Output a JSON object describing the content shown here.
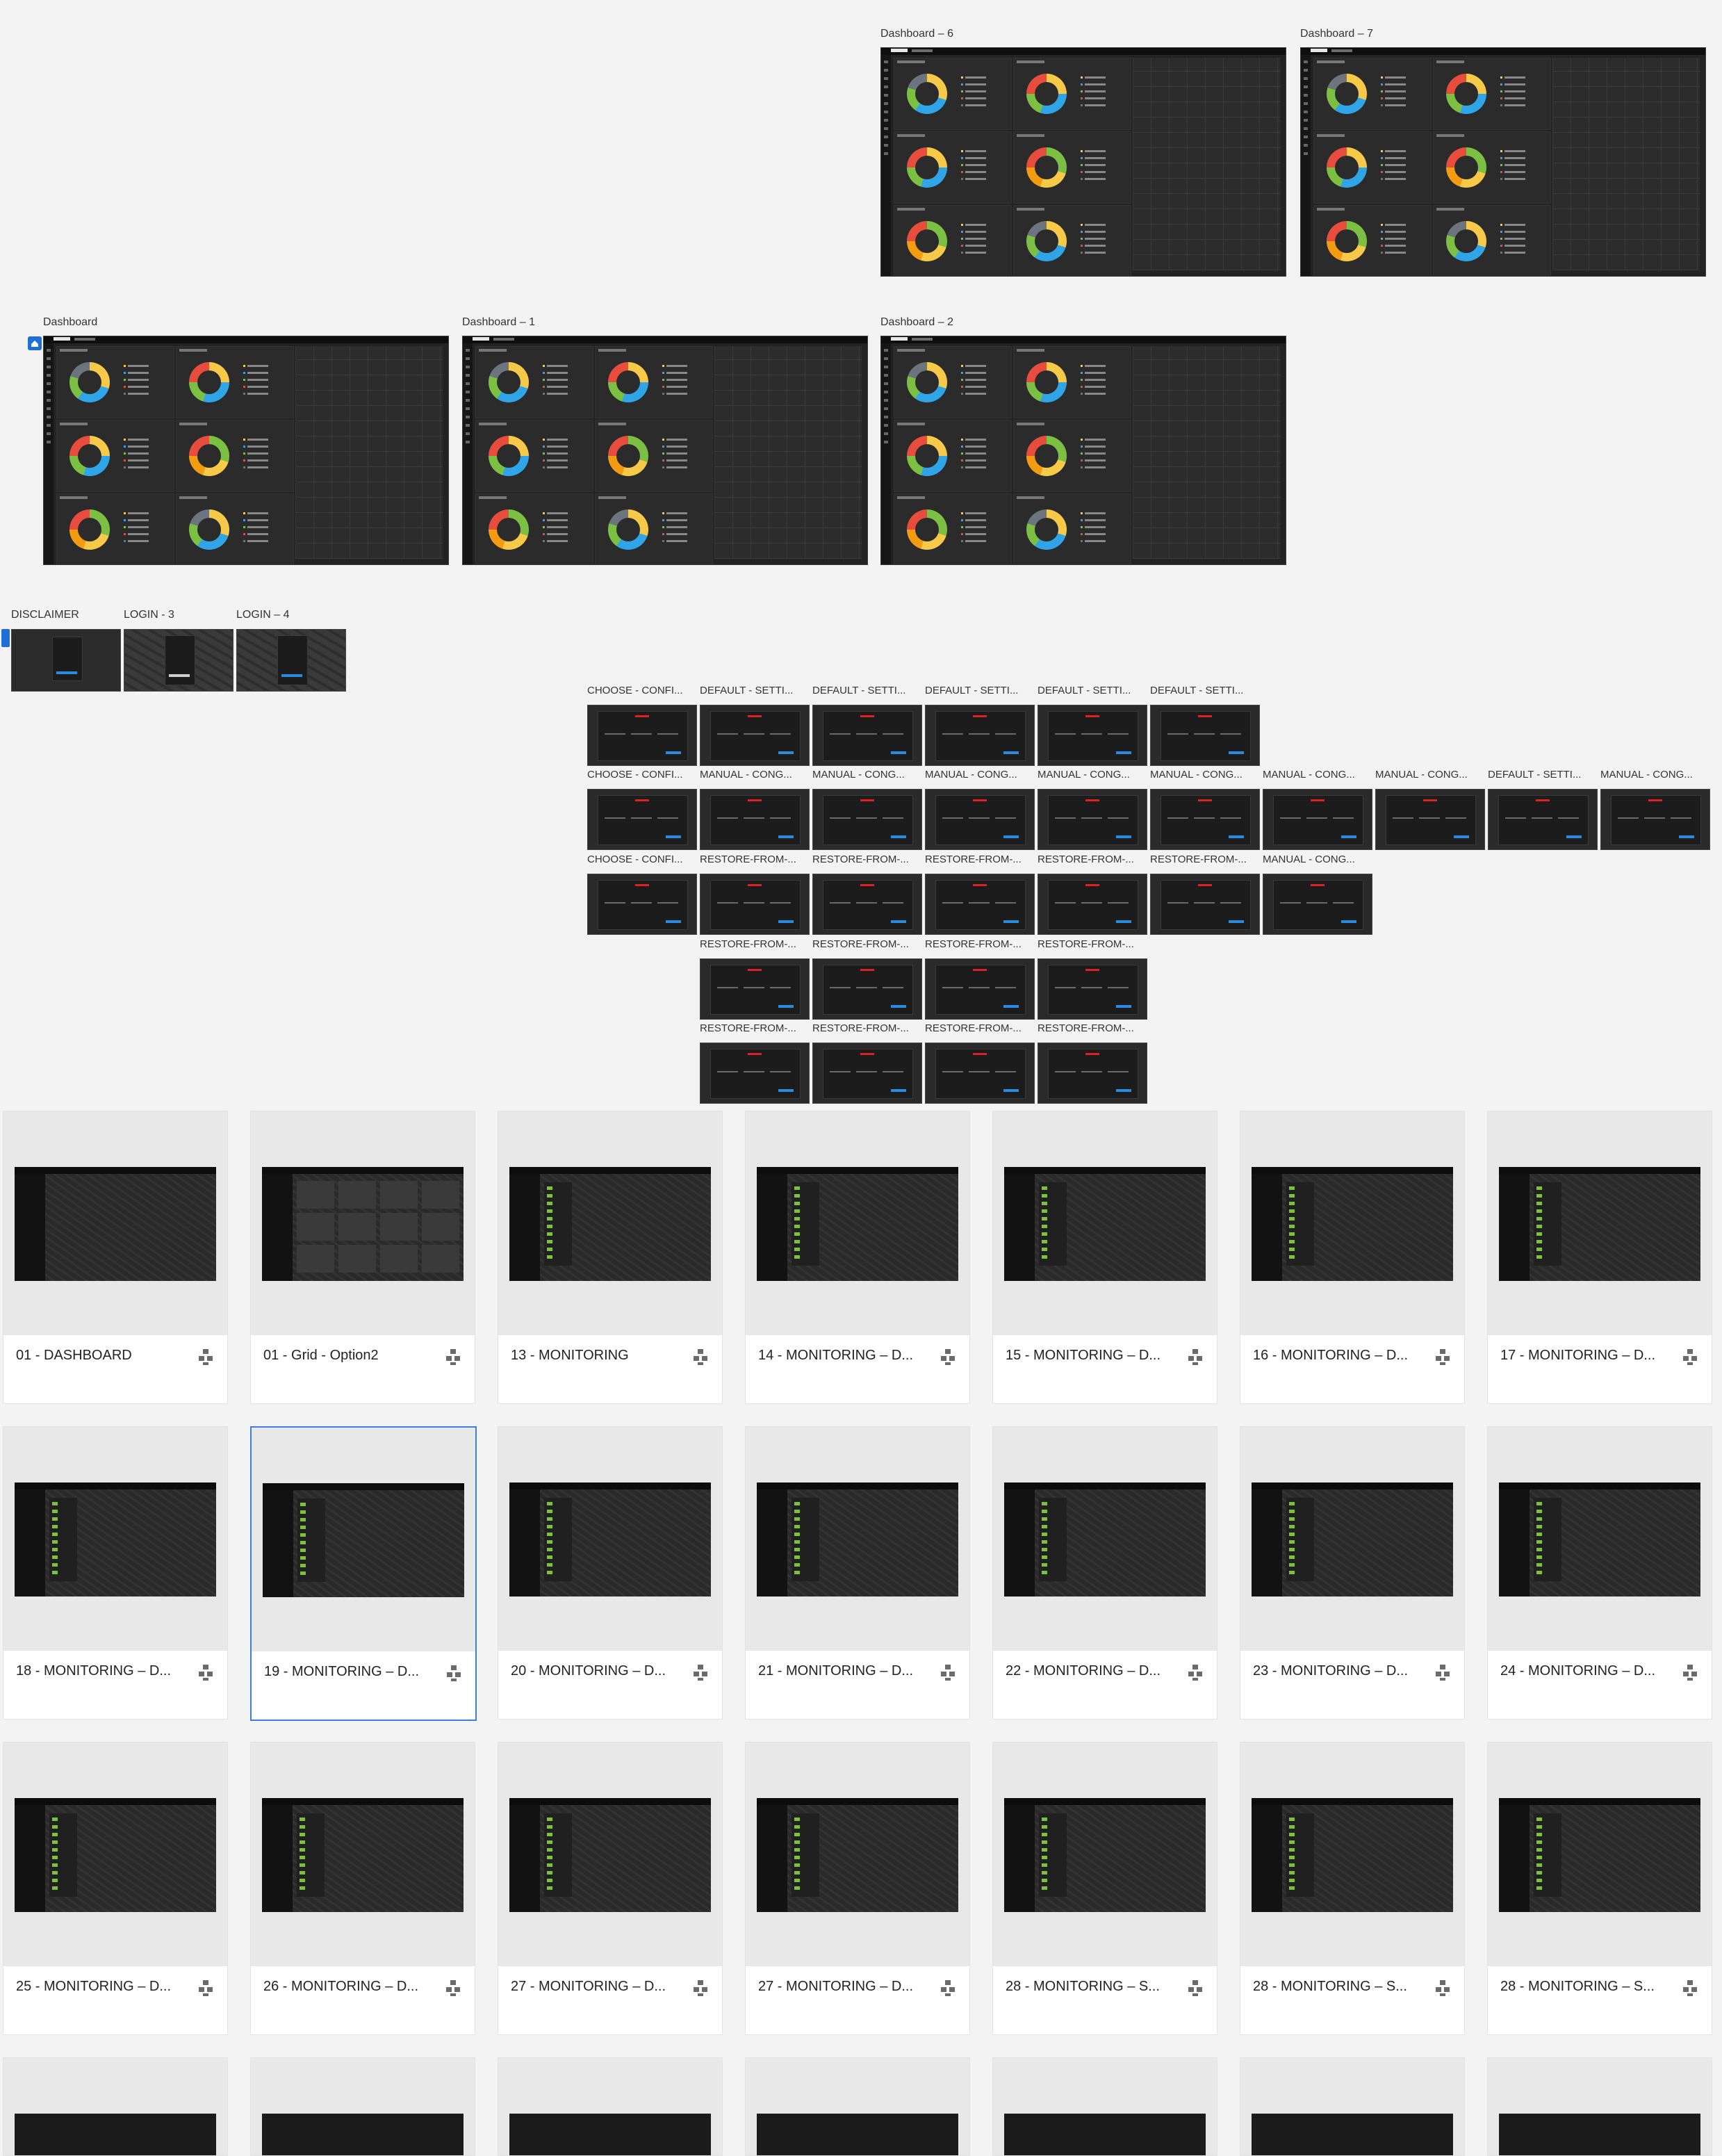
{
  "dashboards": {
    "top_row": [
      {
        "label": "Dashboard – 6"
      },
      {
        "label": "Dashboard – 7"
      }
    ],
    "middle_row": [
      {
        "label": "Dashboard"
      },
      {
        "label": "Dashboard – 1"
      },
      {
        "label": "Dashboard – 2"
      }
    ]
  },
  "login_row": [
    "DISCLAIMER",
    "LOGIN - 3",
    "LOGIN – 4"
  ],
  "wizard_labels": {
    "row1": [
      "CHOOSE - CONFI...",
      "DEFAULT - SETTI...",
      "DEFAULT - SETTI...",
      "DEFAULT - SETTI...",
      "DEFAULT - SETTI...",
      "DEFAULT - SETTI..."
    ],
    "row2": [
      "CHOOSE - CONFI...",
      "MANUAL - CONG...",
      "MANUAL - CONG...",
      "MANUAL - CONG...",
      "MANUAL - CONG...",
      "MANUAL - CONG...",
      "MANUAL - CONG...",
      "MANUAL - CONG...",
      "DEFAULT - SETTI...",
      "MANUAL - CONG..."
    ],
    "row3": [
      "CHOOSE - CONFI...",
      "RESTORE-FROM-...",
      "RESTORE-FROM-...",
      "RESTORE-FROM-...",
      "RESTORE-FROM-...",
      "RESTORE-FROM-...",
      "MANUAL - CONG..."
    ],
    "row4": [
      "RESTORE-FROM-...",
      "RESTORE-FROM-...",
      "RESTORE-FROM-...",
      "RESTORE-FROM-..."
    ],
    "row5": [
      "RESTORE-FROM-...",
      "RESTORE-FROM-...",
      "RESTORE-FROM-...",
      "RESTORE-FROM-..."
    ]
  },
  "gallery": {
    "row1": [
      "01 - DASHBOARD",
      "01 - Grid - Option2",
      "13 - MONITORING",
      "14 - MONITORING – D...",
      "15 - MONITORING – D...",
      "16 - MONITORING – D...",
      "17 - MONITORING – D..."
    ],
    "row2": [
      "18 - MONITORING – D...",
      "19 - MONITORING – D...",
      "20 - MONITORING – D...",
      "21 - MONITORING – D...",
      "22 - MONITORING – D...",
      "23 - MONITORING – D...",
      "24 - MONITORING – D..."
    ],
    "row3": [
      "25 - MONITORING – D...",
      "26 - MONITORING – D...",
      "27 - MONITORING – D...",
      "27 - MONITORING – D...",
      "28 - MONITORING – S...",
      "28 - MONITORING – S...",
      "28 - MONITORING – S..."
    ],
    "selected_index": 8,
    "icon": "component-icon"
  },
  "colors": {
    "canvas": "#f3f3f3",
    "dark_ui": "#232323",
    "selection": "#3d7fd8",
    "honeywell_red": "#dd2222",
    "accent_blue": "#2a8ae0"
  }
}
